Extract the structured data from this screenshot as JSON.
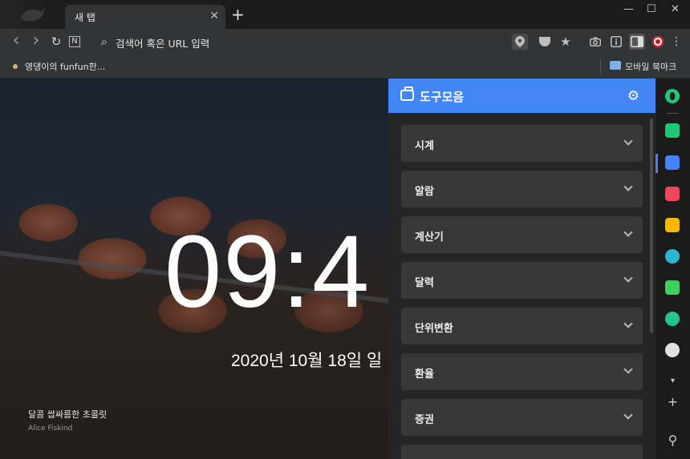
{
  "tab": {
    "title": "새 탭",
    "close_glyph": "✕",
    "new_tab_glyph": "+"
  },
  "window_controls": {
    "minimize": "—",
    "maximize": "☐",
    "close": "✕"
  },
  "toolbar": {
    "back_glyph": "‹",
    "forward_glyph": "›",
    "reload_glyph": "↻",
    "naver_glyph": "N",
    "search_glyph": "⌕",
    "omnibox_placeholder": "검색어 혹은 URL 입력",
    "icons": [
      "map-pin-icon",
      "pocket-icon",
      "star-icon",
      "camera-icon",
      "info-icon",
      "sidebar-toggle-icon",
      "whale-profile-icon",
      "menu-icon"
    ]
  },
  "bookmarks": {
    "item_label": "영댕이의 funfun한...",
    "mobile_label": "모바일 북마크"
  },
  "newtab": {
    "clock": "09:4",
    "date": "2020년 10월 18일 일",
    "photo_title": "달콤 쌉싸름한 초콜릿",
    "photo_author": "Alice Fiskind"
  },
  "panel": {
    "title": "도구모음",
    "gear_glyph": "⚙",
    "items": [
      {
        "label": "시계"
      },
      {
        "label": "알람"
      },
      {
        "label": "계산기"
      },
      {
        "label": "달력"
      },
      {
        "label": "단위변환"
      },
      {
        "label": "환율"
      },
      {
        "label": "증권"
      }
    ]
  },
  "sidebar": {
    "add_glyph": "+",
    "more_glyph": "▾",
    "pin_glyph": "⚲",
    "colors": {
      "green": "#1ec773",
      "blue": "#4285f4",
      "red": "#f0465a",
      "yellow": "#f6b900",
      "teal": "#2bb6d4",
      "lime": "#3ecf5c",
      "mint": "#21c48f"
    }
  }
}
